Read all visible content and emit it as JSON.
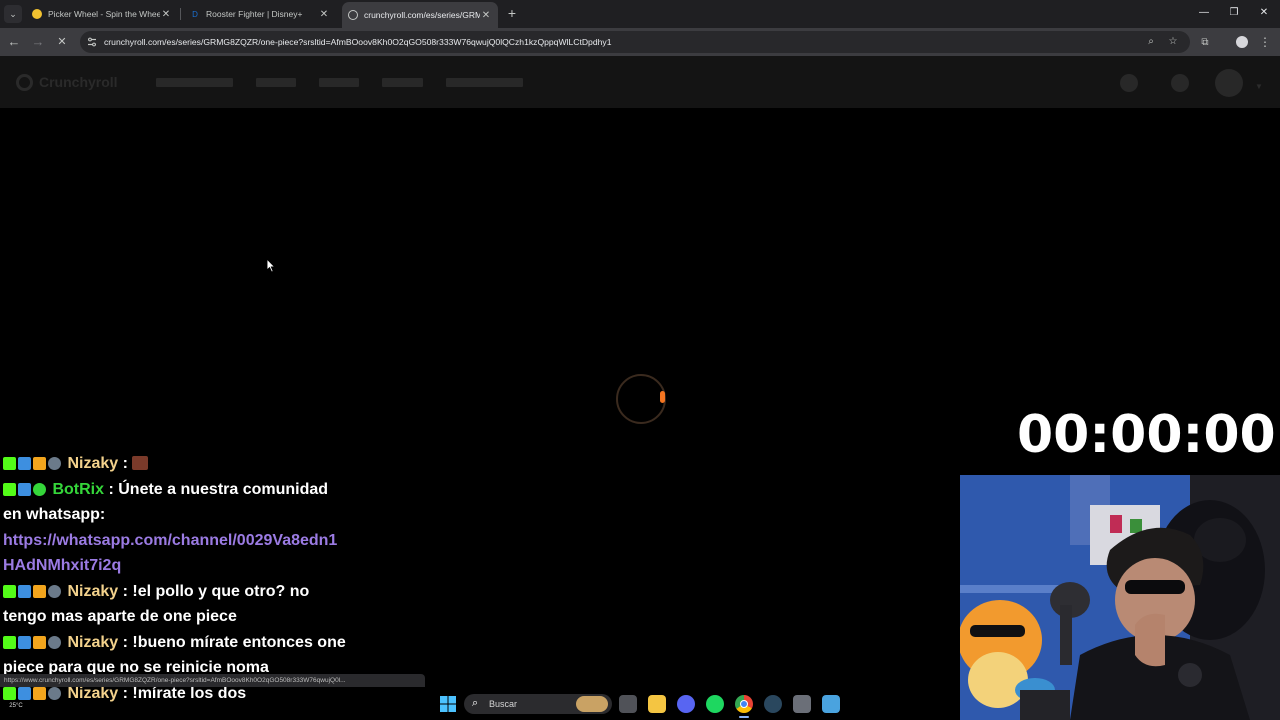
{
  "browser": {
    "tabs": [
      {
        "title": "Picker Wheel - Spin the Wheel to",
        "active": false
      },
      {
        "title": "Rooster Fighter | Disney+",
        "active": false
      },
      {
        "title": "crunchyroll.com/es/series/GRM",
        "active": true
      }
    ],
    "new_tab_label": "+",
    "url": "crunchyroll.com/es/series/GRMG8ZQZR/one-piece?srsltid=AfmBOoov8Kh0O2qGO508r333W76qwujQ0lQCzh1kzQppqWlLCtDpdhy1",
    "icons": [
      "tab-search-icon",
      "back-icon",
      "forward-icon",
      "stop-icon",
      "site-info-icon",
      "zoom-icon",
      "bookmark-star-icon",
      "extensions-icon",
      "profile-icon",
      "menu-icon"
    ]
  },
  "site": {
    "logo_text": "Crunchyroll",
    "loading": true,
    "accent_color": "#f47521"
  },
  "overlay": {
    "timer": "00:00:00"
  },
  "chat": {
    "messages": [
      {
        "user": "Nizaky",
        "sep": " : ",
        "text": "",
        "has_emote": true
      },
      {
        "user": "BotRix",
        "sep": " : ",
        "text": "Únete a nuestra comunidad en whatsapp:",
        "link": "https://whatsapp.com/channel/0029Va8edn1HAdNMhxit7i2q"
      },
      {
        "user": "Nizaky",
        "sep": " : ",
        "text": "!el pollo y que otro? no tengo mas aparte de one piece"
      },
      {
        "user": "Nizaky",
        "sep": " : ",
        "text": "!bueno mírate entonces one piece para que no se reinicie noma"
      },
      {
        "user": "Nizaky",
        "sep": " : ",
        "text": "!mírate los dos"
      }
    ],
    "user_colors": {
      "Nizaky": "#f3d28c",
      "BotRix": "#35d63a",
      "link": "#9b7be3"
    }
  },
  "status_bar": {
    "text": "https://www.crunchyroll.com/es/series/GRMG8ZQZR/one-piece?srsltid=AfmBOoov8Kh0O2qGO508r333W76qwujQ0l..."
  },
  "taskbar": {
    "search_placeholder": "Buscar",
    "weather": "25°C",
    "icons": [
      "windows-start-icon",
      "search-icon",
      "widgets-icon",
      "task-view-icon",
      "file-explorer-icon",
      "discord-icon",
      "spotify-icon",
      "chrome-icon",
      "steam-icon",
      "calculator-icon",
      "notepad-icon"
    ]
  }
}
